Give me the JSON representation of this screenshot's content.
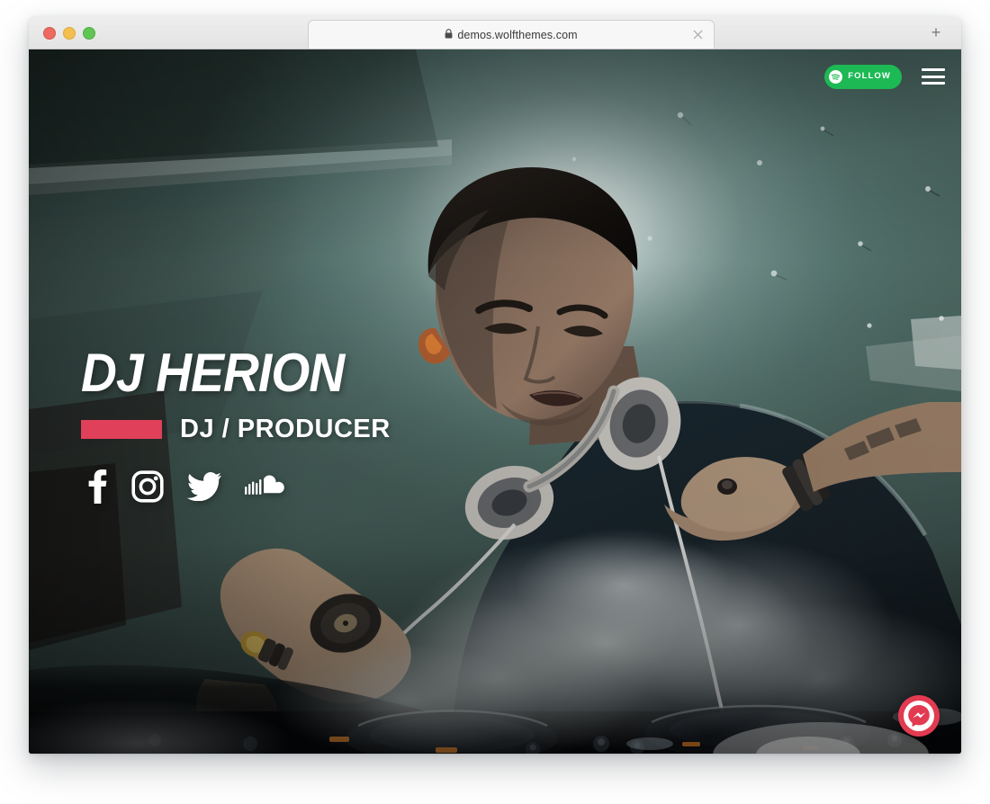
{
  "browser": {
    "traffic_lights": [
      {
        "name": "close-window-button",
        "color": "#ec6a5f"
      },
      {
        "name": "minimize-window-button",
        "color": "#f4bf50"
      },
      {
        "name": "maximize-window-button",
        "color": "#61c554"
      }
    ],
    "tab": {
      "title": "demos.wolfthemes.com",
      "secure_icon": "lock-icon",
      "close_icon": "close-icon"
    },
    "new_tab_label": "+"
  },
  "site": {
    "header": {
      "spotify_follow_label": "FOLLOW",
      "spotify_icon": "spotify-icon",
      "menu_icon": "hamburger-menu-icon"
    },
    "hero": {
      "title": "DJ HERION",
      "subtitle": "DJ / PRODUCER",
      "accent_color": "#e0405a",
      "social": [
        {
          "name": "facebook",
          "icon": "facebook-icon"
        },
        {
          "name": "instagram",
          "icon": "instagram-icon"
        },
        {
          "name": "twitter",
          "icon": "twitter-icon"
        },
        {
          "name": "soundcloud",
          "icon": "soundcloud-icon"
        }
      ]
    },
    "chat_widget": {
      "icon": "facebook-messenger-icon",
      "color": "#e23b51"
    }
  }
}
